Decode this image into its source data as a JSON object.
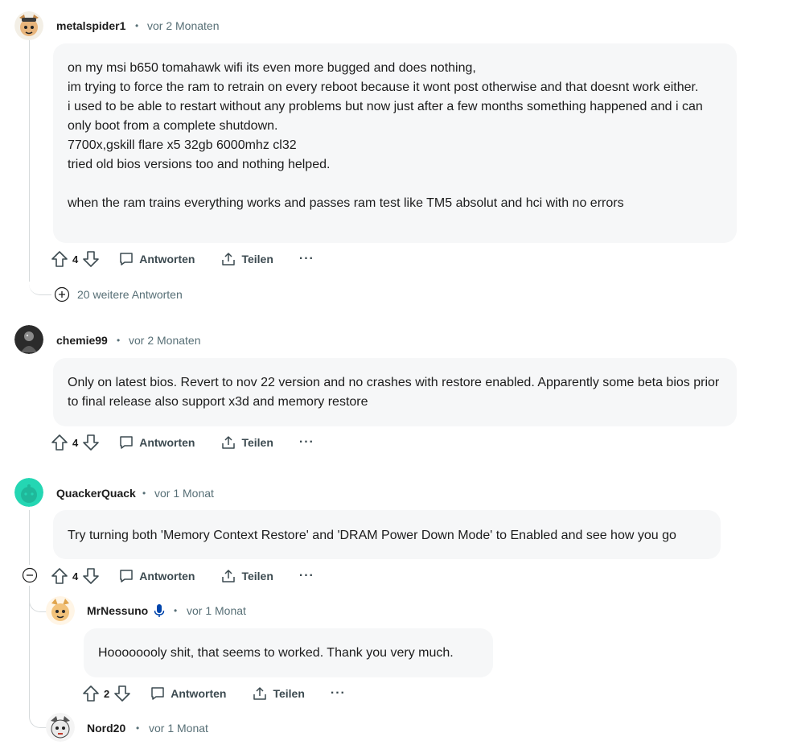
{
  "comments": [
    {
      "username": "metalspider1",
      "dot": "•",
      "time": "vor 2 Monaten",
      "text": "on my msi b650 tomahawk wifi its even more bugged and does nothing,\nim trying to force the ram to retrain on every reboot because it wont post otherwise and that doesnt work either.\ni used to be able to restart without any problems but now just after a few months something happened and i can only boot from a complete shutdown.\n7700x,gskill flare x5 32gb 6000mhz cl32\ntried old bios versions too and nothing helped.\n\nwhen the ram trains everything works and passes ram test like TM5 absolut and hci with no errors",
      "votes": "4",
      "reply_label": "Antworten",
      "share_label": "Teilen",
      "more_label": "···",
      "more_replies": "20 weitere Antworten"
    },
    {
      "username": "chemie99",
      "dot": "•",
      "time": "vor 2 Monaten",
      "text": "Only on latest bios. Revert to nov 22 version and no crashes with restore enabled. Apparently some beta bios prior to final release also support x3d and memory restore",
      "votes": "4",
      "reply_label": "Antworten",
      "share_label": "Teilen",
      "more_label": "···"
    },
    {
      "username": "QuackerQuack",
      "dot": "•",
      "time": "vor 1 Monat",
      "text": "Try turning both 'Memory Context Restore' and 'DRAM Power Down Mode' to Enabled and see how you go",
      "votes": "4",
      "reply_label": "Antworten",
      "share_label": "Teilen",
      "more_label": "···"
    },
    {
      "username": "MrNessuno",
      "dot": "•",
      "time": "vor 1 Monat",
      "text": "Hoooooooly shit, that seems to worked. Thank you very much.",
      "votes": "2",
      "reply_label": "Antworten",
      "share_label": "Teilen",
      "more_label": "···"
    },
    {
      "username": "Nord20",
      "dot": "•",
      "time": "vor 1 Monat"
    }
  ],
  "colors": {
    "bubble_bg": "#f6f7f8",
    "meta_text": "#576f76",
    "action_text": "#3c4a50",
    "accent_mic": "#0045ac",
    "avatar_teal": "#24d6b3"
  },
  "icons": [
    "upvote-icon",
    "downvote-icon",
    "comment-icon",
    "share-icon",
    "plus-circle-icon",
    "minus-circle-icon",
    "microphone-icon"
  ]
}
